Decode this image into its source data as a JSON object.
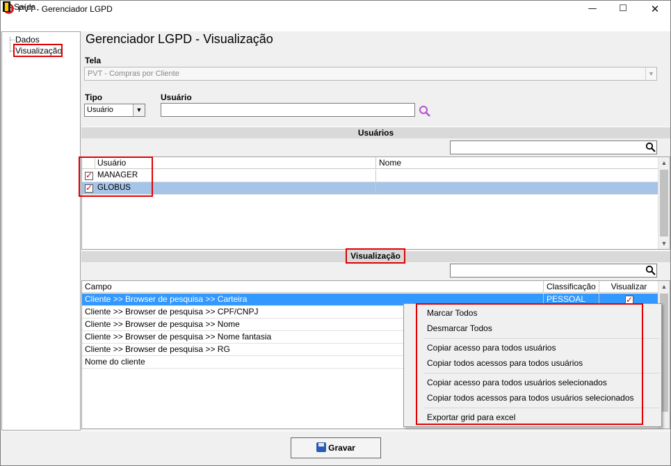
{
  "window": {
    "title": "PVT - Gerenciador LGPD",
    "minimize": "—",
    "maximize": "☐",
    "close": "✕",
    "logo_letter": "G"
  },
  "menu": {
    "exit_label": "Saída"
  },
  "tree": {
    "items": [
      {
        "label": "Dados"
      },
      {
        "label": "Visualização"
      }
    ]
  },
  "page": {
    "title": "Gerenciador LGPD - Visualização"
  },
  "form": {
    "tela_label": "Tela",
    "tela_value": "PVT - Compras por Cliente",
    "tipo_label": "Tipo",
    "tipo_value": "Usuário",
    "usuario_label": "Usuário",
    "usuario_value": ""
  },
  "users_section": {
    "title": "Usuários",
    "columns": [
      "Usuário",
      "Nome"
    ],
    "rows": [
      {
        "checked": true,
        "user": "MANAGER",
        "name": ""
      },
      {
        "checked": true,
        "user": "GLOBUS",
        "name": ""
      }
    ]
  },
  "vis_section": {
    "title": "Visualização",
    "columns": [
      "Campo",
      "Classificação",
      "Visualizar"
    ],
    "rows": [
      {
        "campo": "Cliente >> Browser de pesquisa >> Carteira",
        "classificacao": "PESSOAL",
        "visualizar": true
      },
      {
        "campo": "Cliente >> Browser de pesquisa >> CPF/CNPJ",
        "classificacao": "",
        "visualizar": false
      },
      {
        "campo": "Cliente >> Browser de pesquisa >> Nome",
        "classificacao": "",
        "visualizar": false
      },
      {
        "campo": "Cliente >> Browser de pesquisa >> Nome fantasia",
        "classificacao": "",
        "visualizar": false
      },
      {
        "campo": "Cliente >> Browser de pesquisa >> RG",
        "classificacao": "",
        "visualizar": false
      },
      {
        "campo": "Nome do cliente",
        "classificacao": "",
        "visualizar": false
      }
    ]
  },
  "context_menu": {
    "items": [
      "Marcar Todos",
      "Desmarcar Todos",
      "Copiar acesso para todos usuários",
      "Copiar todos acessos para todos usuários",
      "Copiar acesso para todos usuários selecionados",
      "Copiar todos acessos para todos usuários selecionados",
      "Exportar grid para excel"
    ]
  },
  "footer": {
    "save_label": "Gravar"
  },
  "colors": {
    "highlight": "#e00000",
    "selection": "#3399ff",
    "user_selection": "#a6c3e8"
  }
}
